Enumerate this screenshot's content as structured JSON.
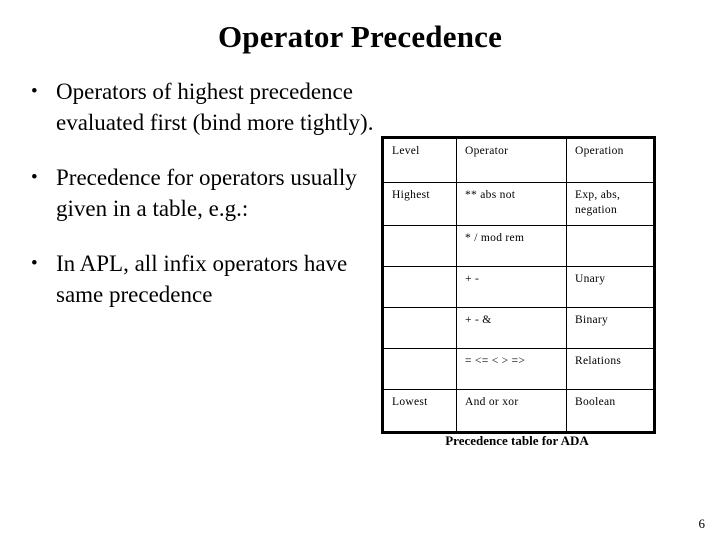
{
  "slide": {
    "title": "Operator Precedence",
    "page_number": "6",
    "bullet_marker": "•",
    "bullets": [
      {
        "text": "Operators of highest precedence evaluated first (bind more tightly)."
      },
      {
        "text": "Precedence for operators usually given in a table, e.g.:"
      },
      {
        "text": "In APL, all infix operators have same precedence"
      }
    ]
  },
  "table": {
    "caption": "Precedence table for ADA",
    "columns": [
      "Level",
      "Operator",
      "Operation"
    ],
    "rows": [
      {
        "level": "Highest",
        "operator": "** abs not",
        "operation": "Exp, abs, negation"
      },
      {
        "level": "",
        "operator": "* / mod rem",
        "operation": ""
      },
      {
        "level": "",
        "operator": "+ -",
        "operation": "Unary"
      },
      {
        "level": "",
        "operator": "+ - &",
        "operation": "Binary"
      },
      {
        "level": "",
        "operator": "= <= < > =>",
        "operation": "Relations"
      },
      {
        "level": "Lowest",
        "operator": "And or xor",
        "operation": "Boolean"
      }
    ]
  },
  "colors": {
    "background": "#ffffff",
    "text": "#000000",
    "table_border": "#000000"
  }
}
